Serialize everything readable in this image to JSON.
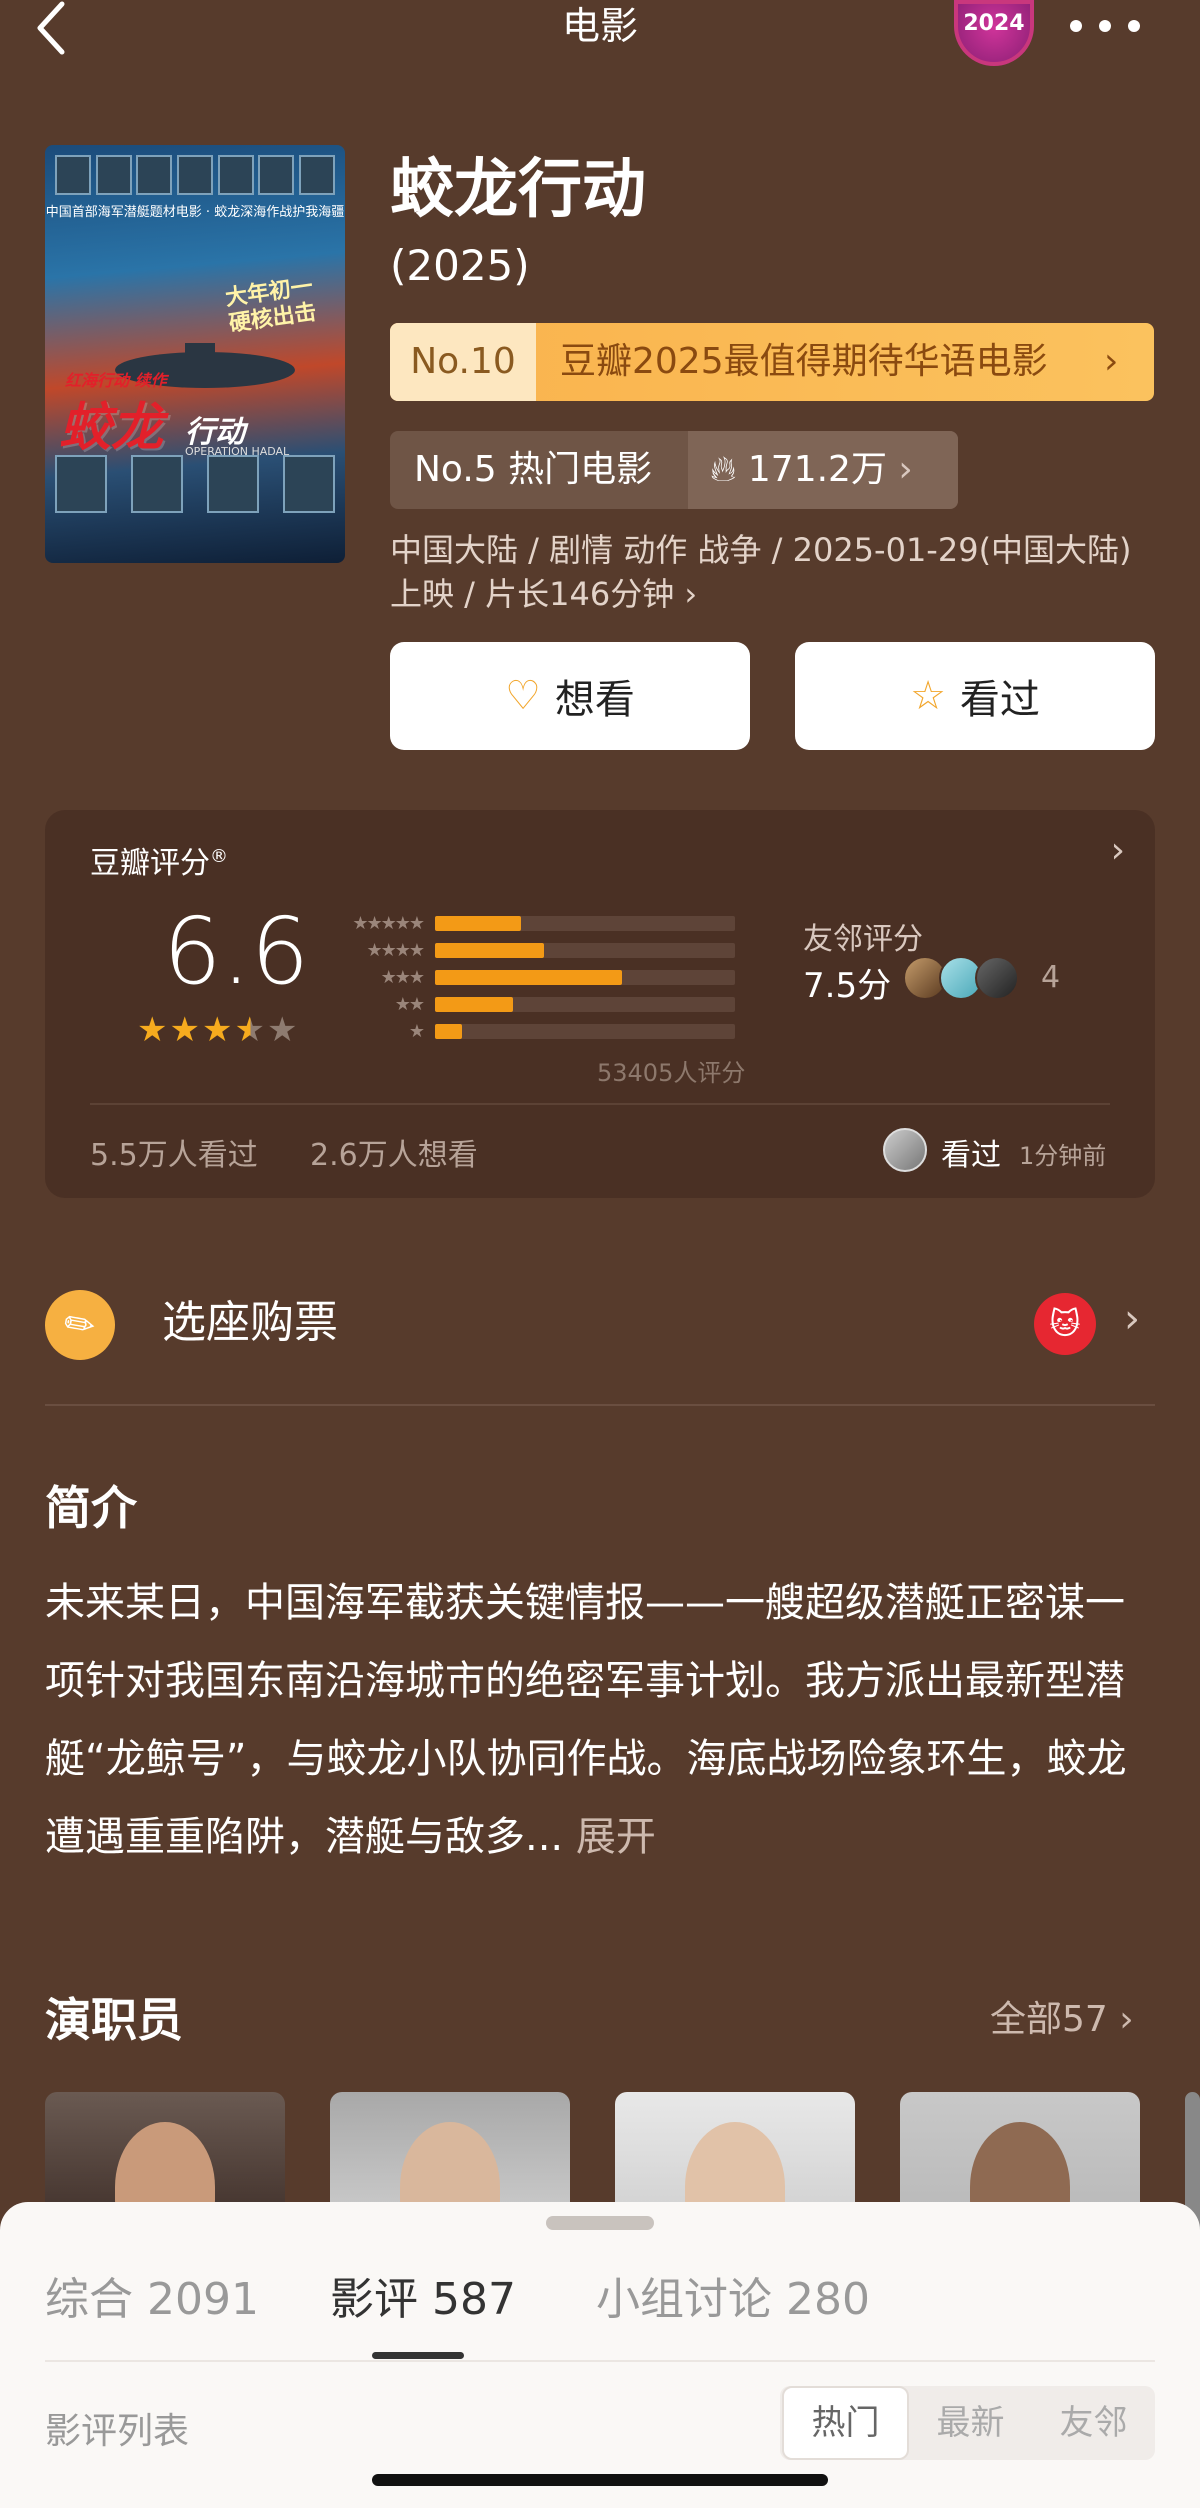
{
  "nav": {
    "title": "电影",
    "badge": "2024"
  },
  "movie": {
    "title": "蛟龙行动",
    "year": "(2025)",
    "rank1": {
      "no": "No.10",
      "text": "豆瓣2025最值得期待华语电影"
    },
    "rank2": {
      "text": "No.5 热门电影",
      "heat": "171.2万"
    },
    "meta_line1": "中国大陆 / 剧情 动作 战争 / 2025-01-29(中国大陆)",
    "meta_line2": "上映 / 片长146分钟 ›",
    "want_label": "想看",
    "seen_label": "看过"
  },
  "poster": {
    "caption": "中国首部海军潜艇题材电影 · 蛟龙深海作战护我海疆",
    "slogan": "大年初一\n硬核出击",
    "logo_text": "蛟龙",
    "logo_sub": "行动",
    "small_text": "红海行动 续作",
    "en_sub": "OPERATION HADAL"
  },
  "rating": {
    "title": "豆瓣评分",
    "score": "6.6",
    "stars_value": 3.5,
    "distribution": [
      {
        "stars": "★★★★★",
        "fraction": 0.11
      },
      {
        "stars": "★★★★",
        "fraction": 0.14
      },
      {
        "stars": "★★★",
        "fraction": 0.24
      },
      {
        "stars": "★★",
        "fraction": 0.1
      },
      {
        "stars": "★",
        "fraction": 0.035
      }
    ],
    "count": "53405人评分",
    "friend_label": "友邻评分",
    "friend_score": "7.5分",
    "friend_count": "4",
    "seen_count": "5.5万人看过",
    "want_count": "2.6万人想看",
    "activity_text": "看过",
    "activity_time": "1分钟前"
  },
  "ticket": {
    "label": "选座购票"
  },
  "intro": {
    "heading": "简介",
    "body": "未来某日，中国海军截获关键情报——一艘超级潜艇正密谋一项针对我国东南沿海城市的绝密军事计划。我方派出最新型潜艇“龙鲸号”，与蛟龙小队协同作战。海底战场险象环生，蛟龙遭遇重重陷阱，潜艇与敌多...",
    "more": "展开"
  },
  "cast": {
    "heading": "演职员",
    "all": "全部57 ›"
  },
  "sheet": {
    "tabs": [
      "综合 2091",
      "影评 587",
      "小组讨论 280"
    ],
    "list_label": "影评列表",
    "segments": [
      "热门",
      "最新",
      "友邻"
    ]
  },
  "colors": {
    "bg": "#573b2c",
    "accent": "#f39a16",
    "card": "#4a3024"
  }
}
